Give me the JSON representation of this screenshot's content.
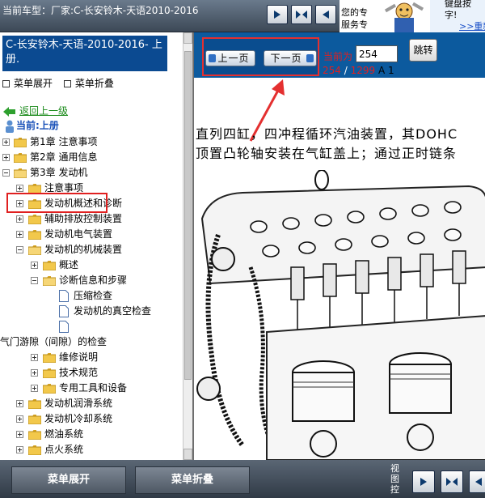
{
  "header": {
    "title": "当前车型：厂家:C-长安铃木-天语2010-2016",
    "service_text": [
      "您的专",
      "服务专"
    ],
    "service_right_text": [
      "键盘按",
      "字!"
    ],
    "service_link": ">>重新"
  },
  "sidebar": {
    "header_title": "C-长安铃木-天语-2010-2016- 上册.",
    "expand_all": "菜单展开",
    "collapse_all": "菜单折叠",
    "back_link": "返回上一级",
    "current_label": "当前:上册",
    "tree": [
      {
        "label": "第1章 注意事项"
      },
      {
        "label": "第2章 通用信息"
      },
      {
        "label": "第3章 发动机"
      },
      {
        "label": "注意事项"
      },
      {
        "label": "发动机概述和诊断"
      },
      {
        "label": "辅助排放控制装置"
      },
      {
        "label": "发动机电气装置"
      },
      {
        "label": "发动机的机械装置"
      },
      {
        "label": "概述"
      },
      {
        "label": "诊断信息和步骤"
      },
      {
        "label": "压缩检查"
      },
      {
        "label": "发动机的真空检查"
      },
      {
        "label": ""
      },
      {
        "label": "气门游隙（间隙）的检查"
      },
      {
        "label": "维修说明"
      },
      {
        "label": "技术规范"
      },
      {
        "label": "专用工具和设备"
      },
      {
        "label": "发动机润滑系统"
      },
      {
        "label": "发动机冷却系统"
      },
      {
        "label": "燃油系统"
      },
      {
        "label": "点火系统"
      }
    ]
  },
  "toolbar": {
    "prev_page": "上一页",
    "next_page": "下一页",
    "current_label": "当前为",
    "page_value": "254",
    "jump_label": "跳转",
    "page_current": "254",
    "page_total": "1299",
    "page_slash": " / ",
    "page_suffix_a": "A",
    "page_suffix_num": "1"
  },
  "content": {
    "lines": [
      "直列四缸，四冲程循环汽油装置，其DOHC",
      "顶置凸轮轴安装在气缸盖上；通过正时链条"
    ]
  },
  "bottom": {
    "expand_label": "菜单展开",
    "collapse_label": "菜单折叠",
    "view_label": "视图控"
  },
  "colors": {
    "accent_blue": "#0c5a9e",
    "highlight_red": "#e02020"
  }
}
